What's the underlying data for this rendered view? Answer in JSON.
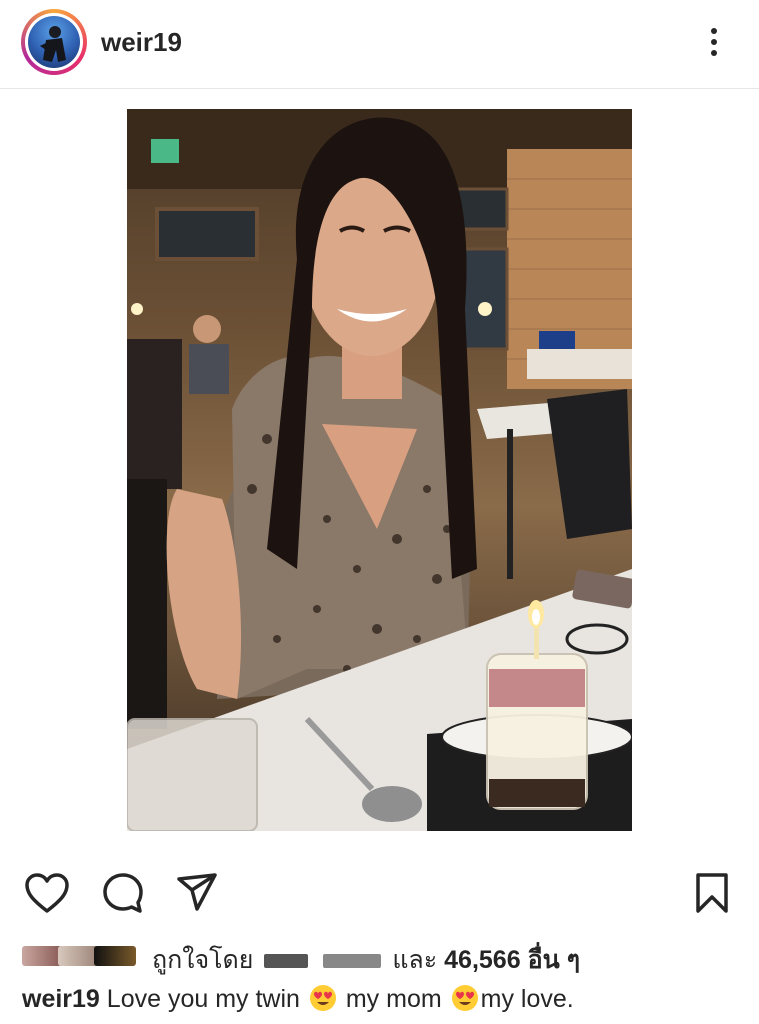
{
  "header": {
    "username": "weir19"
  },
  "post": {
    "likes": {
      "prefix": "ถูกใจโดย",
      "conjunction": "และ",
      "count": "46,566",
      "suffix": "อื่น ๆ"
    },
    "caption": {
      "username": "weir19",
      "part1": "Love you my twin",
      "part2": "my mom",
      "part3": "my love."
    }
  },
  "icons": {
    "like": "heart-icon",
    "comment": "comment-icon",
    "share": "send-icon",
    "save": "bookmark-icon",
    "more": "more-vertical-icon",
    "emoji": "heart-eyes-emoji"
  }
}
